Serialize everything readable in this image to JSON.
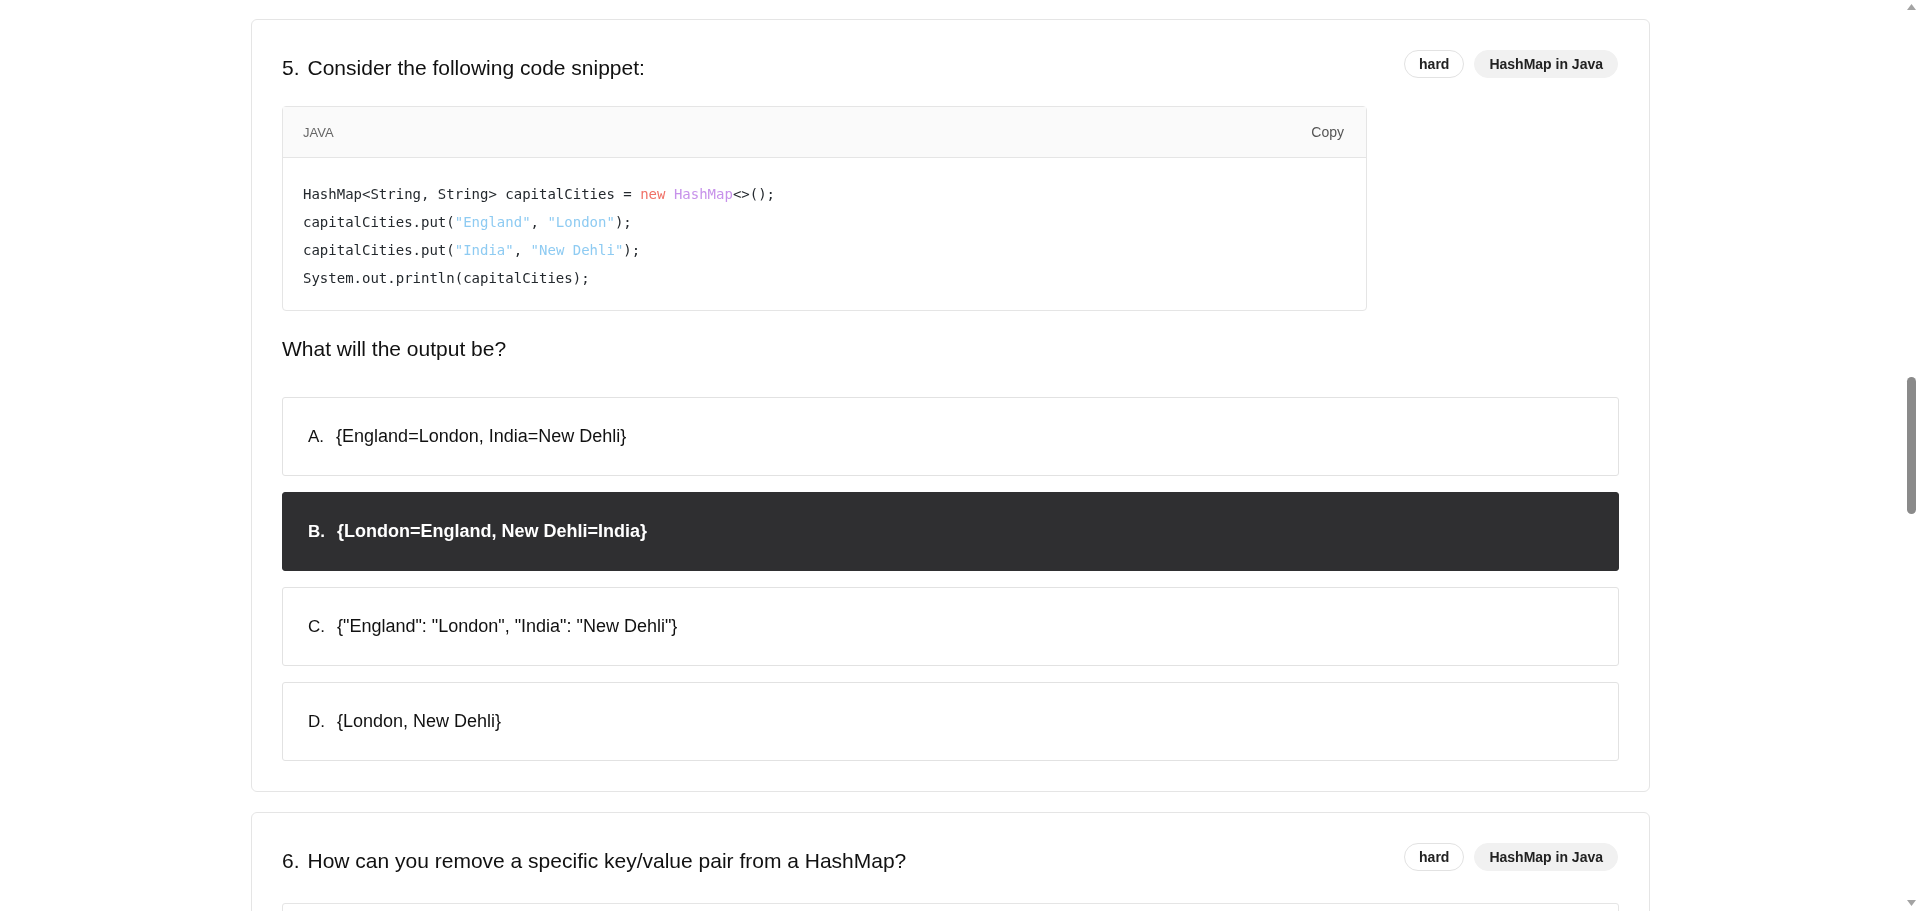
{
  "questions": [
    {
      "number": "5.",
      "title": "Consider the following code snippet:",
      "tags": [
        "hard",
        "HashMap in Java"
      ],
      "code": {
        "language": "JAVA",
        "copy_label": "Copy",
        "lines": [
          [
            {
              "kind": "plain",
              "text": "HashMap<String, String> capitalCities = "
            },
            {
              "kind": "keyword",
              "text": "new "
            },
            {
              "kind": "type",
              "text": "HashMap"
            },
            {
              "kind": "plain",
              "text": "<>();"
            }
          ],
          [
            {
              "kind": "plain",
              "text": "capitalCities.put("
            },
            {
              "kind": "string",
              "text": "\"England\""
            },
            {
              "kind": "plain",
              "text": ", "
            },
            {
              "kind": "string",
              "text": "\"London\""
            },
            {
              "kind": "plain",
              "text": ");"
            }
          ],
          [
            {
              "kind": "plain",
              "text": "capitalCities.put("
            },
            {
              "kind": "string",
              "text": "\"India\""
            },
            {
              "kind": "plain",
              "text": ", "
            },
            {
              "kind": "string",
              "text": "\"New Dehli\""
            },
            {
              "kind": "plain",
              "text": ");"
            }
          ],
          [
            {
              "kind": "plain",
              "text": "System.out.println(capitalCities);"
            }
          ]
        ]
      },
      "prompt": "What will the output be?",
      "options": [
        {
          "letter": "A.",
          "text": "{England=London, India=New Dehli}",
          "selected": false
        },
        {
          "letter": "B.",
          "text": "{London=England, New Dehli=India}",
          "selected": true
        },
        {
          "letter": "C.",
          "text": "{\"England\": \"London\", \"India\": \"New Dehli\"}",
          "selected": false
        },
        {
          "letter": "D.",
          "text": "{London, New Dehli}",
          "selected": false
        }
      ]
    },
    {
      "number": "6.",
      "title": "How can you remove a specific key/value pair from a HashMap?",
      "tags": [
        "hard",
        "HashMap in Java"
      ]
    }
  ]
}
